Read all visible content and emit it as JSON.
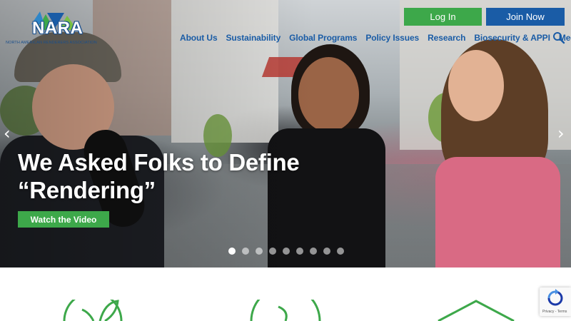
{
  "brand": {
    "name": "NARA",
    "tagline": "NORTH AMERICAN RENDERERS ASSOCIATION"
  },
  "header": {
    "login_label": "Log In",
    "join_label": "Join Now",
    "search_icon": "search-icon"
  },
  "nav": {
    "items": [
      {
        "label": "About Us"
      },
      {
        "label": "Sustainability"
      },
      {
        "label": "Global Programs"
      },
      {
        "label": "Policy Issues"
      },
      {
        "label": "Research"
      },
      {
        "label": "Biosecurity & APPI"
      },
      {
        "label": "Media"
      }
    ]
  },
  "hero": {
    "title": "We Asked Folks to Define “Rendering”",
    "cta_label": "Watch the Video",
    "prev_arrow": "‹",
    "next_arrow": "›",
    "slide_count": 9,
    "active_slide": 1
  },
  "colors": {
    "brand_blue": "#1a5ca6",
    "brand_green": "#3da84a"
  },
  "recaptcha": {
    "links": "Privacy - Terms"
  }
}
